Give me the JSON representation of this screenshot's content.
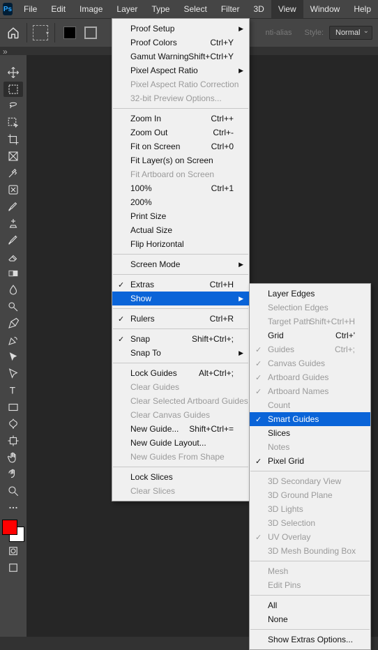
{
  "menu_bar": {
    "items": [
      "File",
      "Edit",
      "Image",
      "Layer",
      "Type",
      "Select",
      "Filter",
      "3D",
      "View",
      "Window",
      "Help"
    ],
    "active_index": 8
  },
  "options_bar": {
    "anti_alias_label": "nti-alias",
    "style_label": "Style:",
    "style_value": "Normal"
  },
  "swatch": {
    "fg": "#ff0000",
    "bg": "#ffffff"
  },
  "tools": [
    "move-tool",
    "rectangular-marquee-tool",
    "lasso-tool",
    "object-selection-tool",
    "crop-tool",
    "frame-tool",
    "eyedropper-tool",
    "spot-healing-brush-tool",
    "brush-tool",
    "clone-stamp-tool",
    "history-brush-tool",
    "eraser-tool",
    "gradient-tool",
    "blur-tool",
    "dodge-tool",
    "pen-tool",
    "horizontal-type-tool",
    "path-selection-tool",
    "rectangle-tool",
    "hand-tool",
    "zoom-tool",
    "artboard-tool",
    "curvature-pen-tool",
    "direct-selection-tool",
    "custom-shape-tool",
    "rotate-view-tool",
    "edit-toolbar"
  ],
  "view_menu": [
    {
      "label": "Proof Setup",
      "sub": true
    },
    {
      "label": "Proof Colors",
      "shortcut": "Ctrl+Y"
    },
    {
      "label": "Gamut Warning",
      "shortcut": "Shift+Ctrl+Y"
    },
    {
      "label": "Pixel Aspect Ratio",
      "sub": true
    },
    {
      "label": "Pixel Aspect Ratio Correction",
      "disabled": true
    },
    {
      "label": "32-bit Preview Options...",
      "disabled": true
    },
    {
      "sep": true
    },
    {
      "label": "Zoom In",
      "shortcut": "Ctrl++"
    },
    {
      "label": "Zoom Out",
      "shortcut": "Ctrl+-"
    },
    {
      "label": "Fit on Screen",
      "shortcut": "Ctrl+0"
    },
    {
      "label": "Fit Layer(s) on Screen"
    },
    {
      "label": "Fit Artboard on Screen",
      "disabled": true
    },
    {
      "label": "100%",
      "shortcut": "Ctrl+1"
    },
    {
      "label": "200%"
    },
    {
      "label": "Print Size"
    },
    {
      "label": "Actual Size"
    },
    {
      "label": "Flip Horizontal"
    },
    {
      "sep": true
    },
    {
      "label": "Screen Mode",
      "sub": true
    },
    {
      "sep": true
    },
    {
      "label": "Extras",
      "shortcut": "Ctrl+H",
      "checked": true
    },
    {
      "label": "Show",
      "sub": true,
      "highlight": true
    },
    {
      "sep": true
    },
    {
      "label": "Rulers",
      "shortcut": "Ctrl+R",
      "checked": true
    },
    {
      "sep": true
    },
    {
      "label": "Snap",
      "shortcut": "Shift+Ctrl+;",
      "checked": true
    },
    {
      "label": "Snap To",
      "sub": true
    },
    {
      "sep": true
    },
    {
      "label": "Lock Guides",
      "shortcut": "Alt+Ctrl+;"
    },
    {
      "label": "Clear Guides",
      "disabled": true
    },
    {
      "label": "Clear Selected Artboard Guides",
      "disabled": true
    },
    {
      "label": "Clear Canvas Guides",
      "disabled": true
    },
    {
      "label": "New Guide...",
      "shortcut": "Shift+Ctrl+="
    },
    {
      "label": "New Guide Layout..."
    },
    {
      "label": "New Guides From Shape",
      "disabled": true
    },
    {
      "sep": true
    },
    {
      "label": "Lock Slices"
    },
    {
      "label": "Clear Slices",
      "disabled": true
    }
  ],
  "show_submenu": [
    {
      "label": "Layer Edges"
    },
    {
      "label": "Selection Edges",
      "disabled": true
    },
    {
      "label": "Target Path",
      "shortcut": "Shift+Ctrl+H",
      "disabled": true
    },
    {
      "label": "Grid",
      "shortcut": "Ctrl+'"
    },
    {
      "label": "Guides",
      "shortcut": "Ctrl+;",
      "checked": true,
      "disabled": true
    },
    {
      "label": "Canvas Guides",
      "checked": true,
      "disabled": true
    },
    {
      "label": "Artboard Guides",
      "checked": true,
      "disabled": true
    },
    {
      "label": "Artboard Names",
      "checked": true,
      "disabled": true
    },
    {
      "label": "Count",
      "disabled": true
    },
    {
      "label": "Smart Guides",
      "checked": true,
      "highlight": true
    },
    {
      "label": "Slices"
    },
    {
      "label": "Notes",
      "disabled": true
    },
    {
      "label": "Pixel Grid",
      "checked": true
    },
    {
      "sep": true
    },
    {
      "label": "3D Secondary View",
      "disabled": true
    },
    {
      "label": "3D Ground Plane",
      "disabled": true
    },
    {
      "label": "3D Lights",
      "disabled": true
    },
    {
      "label": "3D Selection",
      "disabled": true
    },
    {
      "label": "UV Overlay",
      "checked": true,
      "disabled": true
    },
    {
      "label": "3D Mesh Bounding Box",
      "disabled": true
    },
    {
      "sep": true
    },
    {
      "label": "Mesh",
      "disabled": true
    },
    {
      "label": "Edit Pins",
      "disabled": true
    },
    {
      "sep": true
    },
    {
      "label": "All"
    },
    {
      "label": "None"
    },
    {
      "sep": true
    },
    {
      "label": "Show Extras Options..."
    }
  ]
}
